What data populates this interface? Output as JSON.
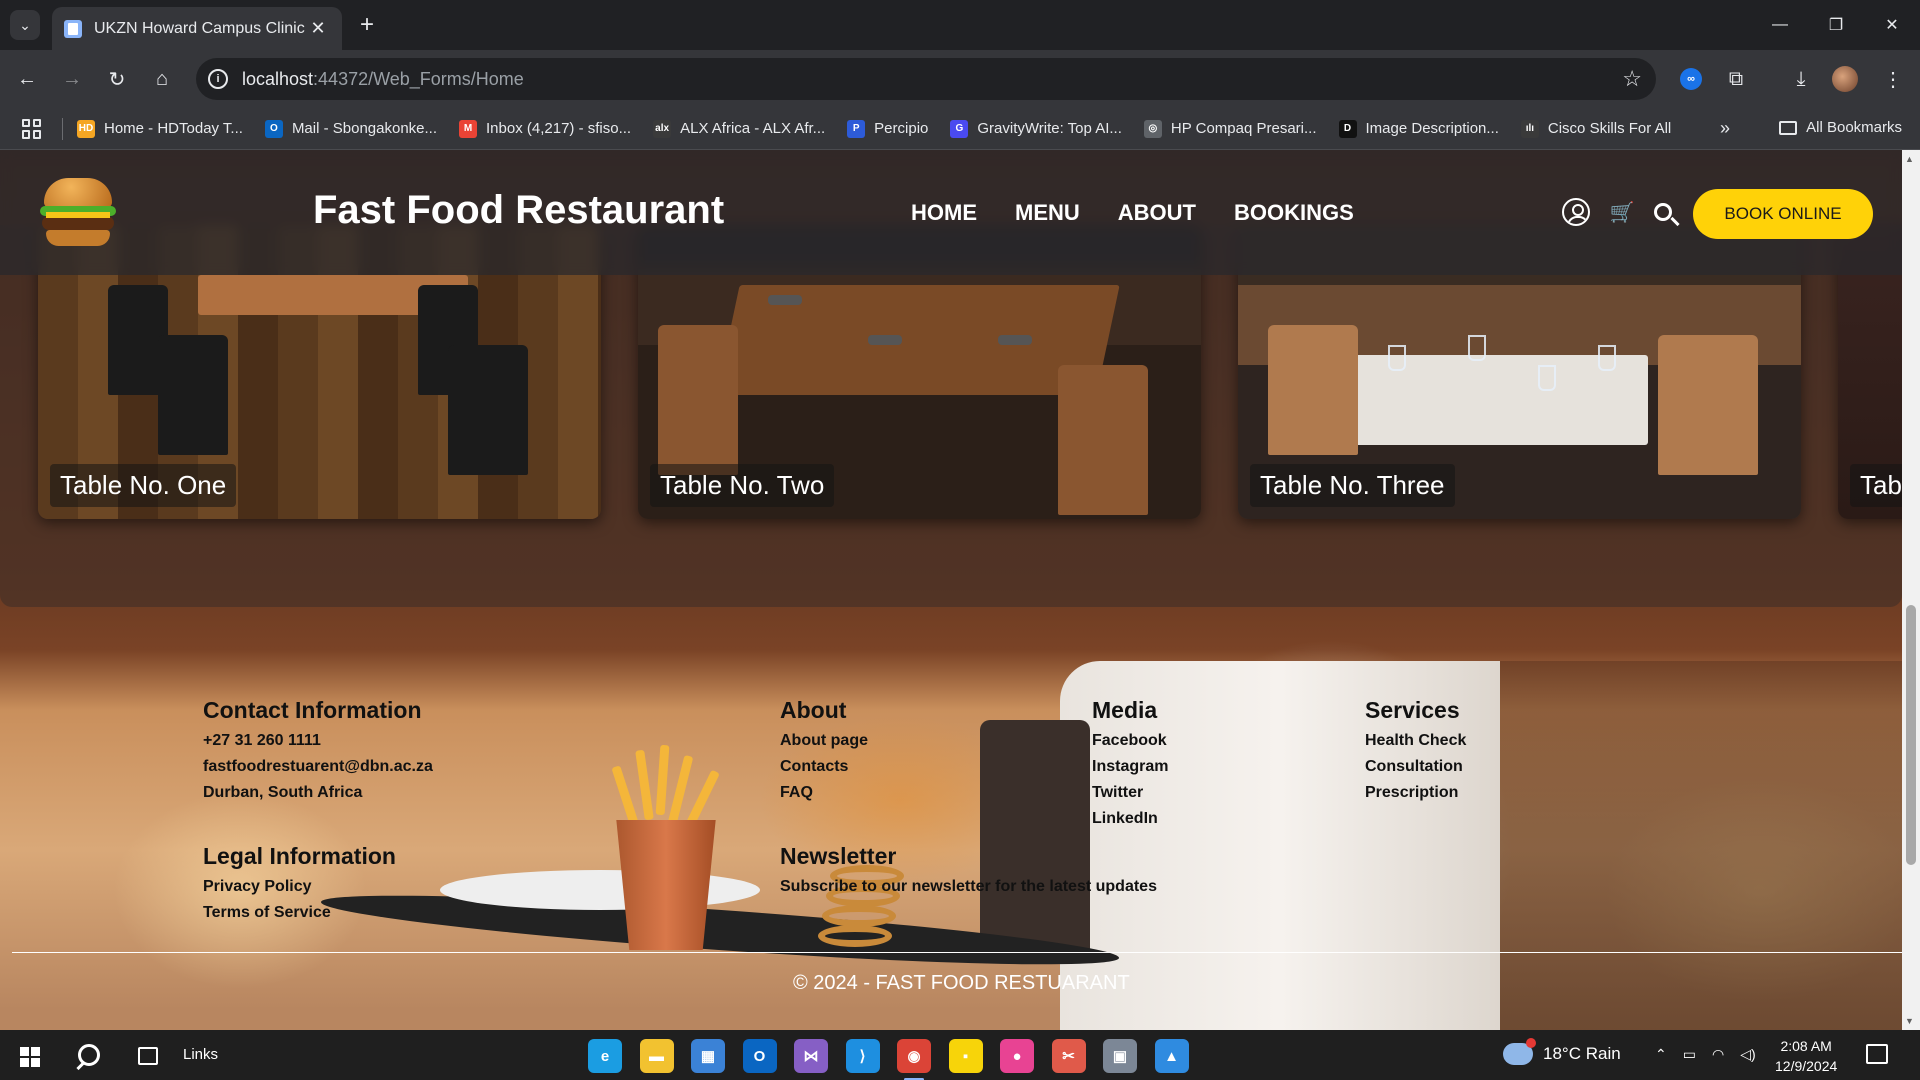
{
  "browser": {
    "tab_title": "UKZN Howard Campus Clinic",
    "url_host": "localhost",
    "url_path": ":44372/Web_Forms/Home",
    "bookmarks": [
      {
        "label": "Home - HDToday T...",
        "icon": "hdtoday-icon",
        "icon_text": "HD",
        "color": "#f5a623"
      },
      {
        "label": "Mail - Sbongakonke...",
        "icon": "outlook-icon",
        "icon_text": "O",
        "color": "#0a66c2"
      },
      {
        "label": "Inbox (4,217) - sfiso...",
        "icon": "gmail-icon",
        "icon_text": "M",
        "color": "#ea4335"
      },
      {
        "label": "ALX Africa - ALX Afr...",
        "icon": "alx-icon",
        "icon_text": "alx",
        "color": "#3a3a3a"
      },
      {
        "label": "Percipio",
        "icon": "percipio-icon",
        "icon_text": "P",
        "color": "#2d5bd8"
      },
      {
        "label": "GravityWrite: Top AI...",
        "icon": "gravitywrite-icon",
        "icon_text": "G",
        "color": "#4a4af0"
      },
      {
        "label": "HP Compaq Presari...",
        "icon": "globe-icon",
        "icon_text": "◎",
        "color": "#5f6368"
      },
      {
        "label": "Image Description...",
        "icon": "image-description-icon",
        "icon_text": "D",
        "color": "#111111"
      },
      {
        "label": "Cisco Skills For All",
        "icon": "cisco-icon",
        "icon_text": "ılı",
        "color": "#3a3a3a"
      }
    ],
    "all_bookmarks": "All Bookmarks"
  },
  "site": {
    "title": "Fast Food Restaurant",
    "nav": [
      "HOME",
      "MENU",
      "ABOUT",
      "BOOKINGS"
    ],
    "book_button": "BOOK ONLINE"
  },
  "tables": [
    {
      "label": "Table No. One"
    },
    {
      "label": "Table No. Two"
    },
    {
      "label": "Table No. Three"
    },
    {
      "label": "Tab"
    }
  ],
  "footer": {
    "contact": {
      "heading": "Contact Information",
      "phone": "+27 31 260 1111",
      "email": "fastfoodrestuarent@dbn.ac.za",
      "location": "Durban, South Africa"
    },
    "legal": {
      "heading": "Legal Information",
      "items": [
        "Privacy Policy",
        "Terms of Service"
      ]
    },
    "about": {
      "heading": "About",
      "items": [
        "About page",
        "Contacts",
        "FAQ"
      ]
    },
    "newsletter": {
      "heading": "Newsletter",
      "text": "Subscribe to our newsletter for the latest updates"
    },
    "media": {
      "heading": "Media",
      "items": [
        "Facebook",
        "Instagram",
        "Twitter",
        "LinkedIn"
      ]
    },
    "services": {
      "heading": "Services",
      "items": [
        "Health Check",
        "Consultation",
        "Prescription"
      ]
    },
    "copyright": "© 2024 - FAST FOOD RESTUARANT"
  },
  "taskbar": {
    "links_label": "Links",
    "weather": "18°C  Rain",
    "time": "2:08 AM",
    "date": "12/9/2024",
    "apps": [
      {
        "name": "edge-icon",
        "glyph": "e",
        "color": "#1b9de2"
      },
      {
        "name": "file-explorer-icon",
        "glyph": "▬",
        "color": "#f2c230"
      },
      {
        "name": "store-icon",
        "glyph": "▦",
        "color": "#3b82d6"
      },
      {
        "name": "outlook-app-icon",
        "glyph": "O",
        "color": "#0a66c2"
      },
      {
        "name": "visual-studio-icon",
        "glyph": "⋈",
        "color": "#865fc5"
      },
      {
        "name": "vscode-icon",
        "glyph": "⟩",
        "color": "#1e8fe0"
      },
      {
        "name": "chrome-icon",
        "glyph": "◉",
        "color": "#db4437"
      },
      {
        "name": "sticky-notes-icon",
        "glyph": "▪",
        "color": "#f7d40a"
      },
      {
        "name": "paint-icon",
        "glyph": "●",
        "color": "#e84393"
      },
      {
        "name": "snipping-tool-icon",
        "glyph": "✂",
        "color": "#e05a4a"
      },
      {
        "name": "hp-support-icon",
        "glyph": "▣",
        "color": "#7c8796"
      },
      {
        "name": "photos-icon",
        "glyph": "▲",
        "color": "#2f8be0"
      }
    ]
  }
}
